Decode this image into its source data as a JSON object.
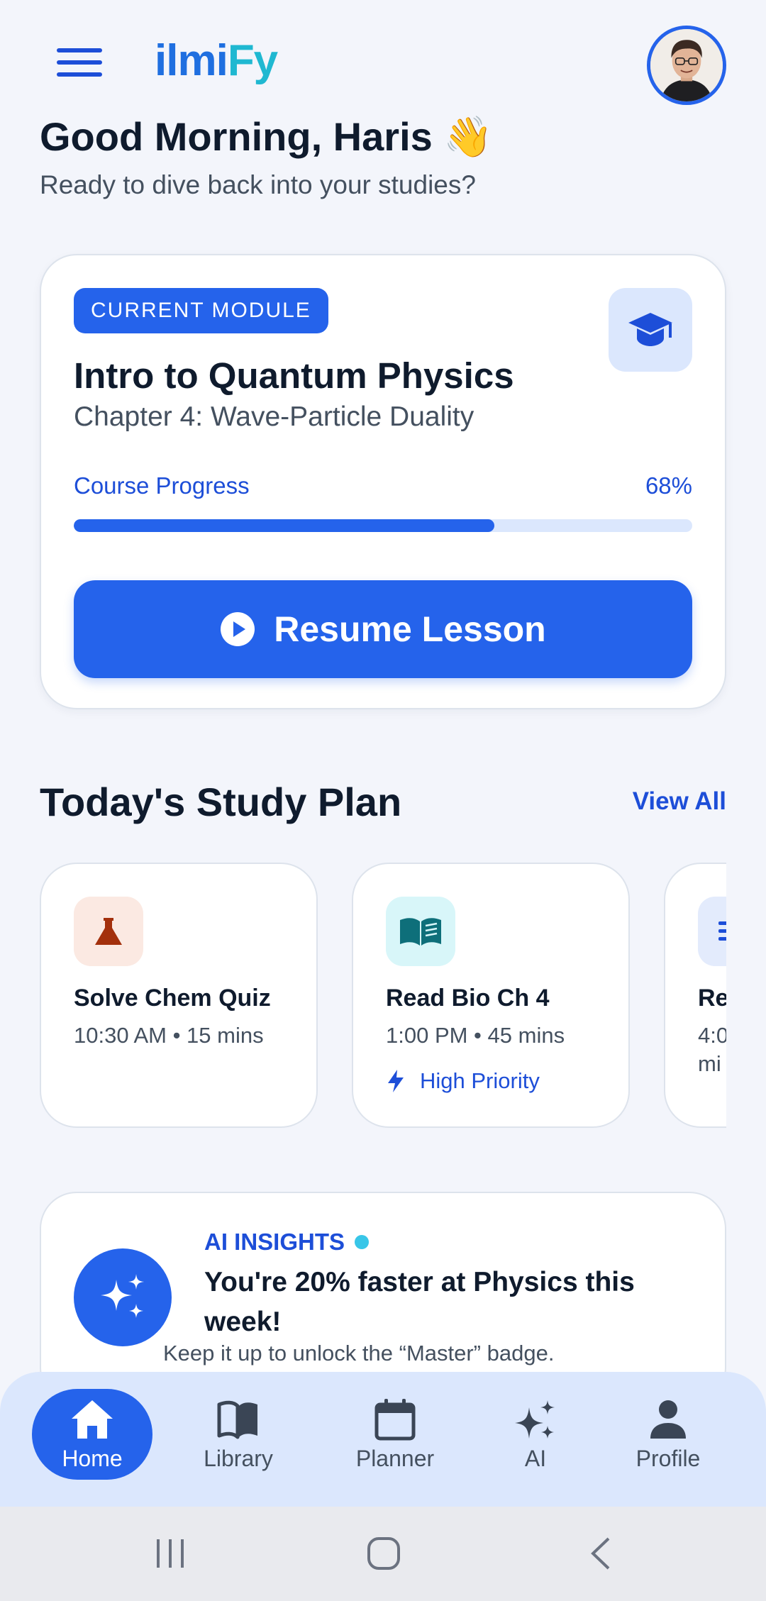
{
  "header": {
    "logo_main": "ilmi",
    "logo_accent": "Fy",
    "greeting": "Good Morning, Haris 👋",
    "subtitle": "Ready to dive back into your studies?"
  },
  "current_module": {
    "badge": "CURRENT MODULE",
    "title": "Intro to Quantum Physics",
    "chapter": "Chapter 4: Wave-Particle Duality",
    "progress_label": "Course Progress",
    "progress_text": "68%",
    "progress_value": 0.68,
    "button_label": "Resume Lesson",
    "icon": "graduation-cap-icon"
  },
  "study_plan": {
    "title": "Today's Study Plan",
    "view_all": "View All",
    "items": [
      {
        "title": "Solve Chem Quiz",
        "meta": "10:30 AM • 15 mins",
        "priority": "",
        "icon": "flask-icon",
        "icon_bg": "#fbe9e2",
        "icon_color": "#a3300c"
      },
      {
        "title": "Read Bio Ch 4",
        "meta": "1:00 PM • 45 mins",
        "priority": "High Priority",
        "icon": "open-book-icon",
        "icon_bg": "#d8f6f9",
        "icon_color": "#0e6f7a"
      },
      {
        "title": "Re",
        "meta": "4:0",
        "meta2": "mi",
        "icon": "list-icon",
        "icon_bg": "#e3ebfc",
        "icon_color": "#1d4ed8"
      }
    ]
  },
  "ai_insights": {
    "tag": "AI INSIGHTS",
    "title": "You're 20% faster at Physics this week!",
    "description": "Keep it up to unlock the “Master” badge."
  },
  "bottom_nav": {
    "items": [
      {
        "label": "Home",
        "icon": "home-icon",
        "active": true
      },
      {
        "label": "Library",
        "icon": "book-icon",
        "active": false
      },
      {
        "label": "Planner",
        "icon": "calendar-icon",
        "active": false
      },
      {
        "label": "AI",
        "icon": "sparkle-icon",
        "active": false
      },
      {
        "label": "Profile",
        "icon": "person-icon",
        "active": false
      }
    ]
  },
  "colors": {
    "primary": "#2563eb",
    "primary_light": "#dbe7fd",
    "background": "#f3f5fb",
    "text_dark": "#0f1b2d",
    "text_muted": "#44505f",
    "accent_cyan": "#38c6e8"
  }
}
